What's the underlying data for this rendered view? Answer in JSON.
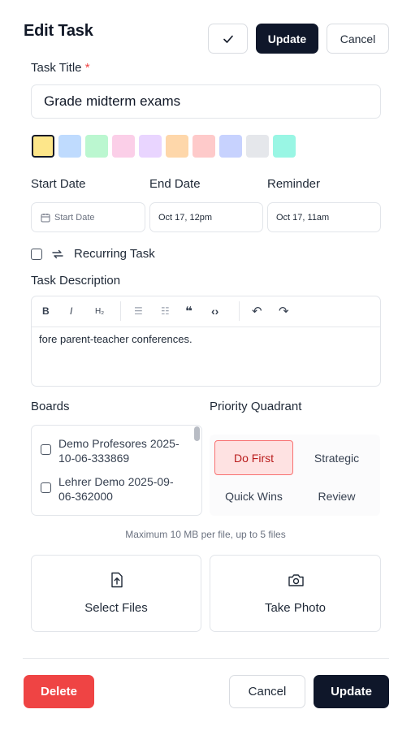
{
  "header": {
    "title": "Edit Task",
    "confirm_icon": "check-icon",
    "update_label": "Update",
    "cancel_label": "Cancel"
  },
  "task_title": {
    "label": "Task Title",
    "required_mark": "*",
    "value": "Grade midterm exams"
  },
  "colors": {
    "swatches": [
      "#fde68a",
      "#bfdbfe",
      "#bbf7d0",
      "#fbcfe8",
      "#e9d5ff",
      "#fed7aa",
      "#fecaca",
      "#c7d2fe",
      "#e5e7eb",
      "#99f6e4"
    ],
    "selected_index": 0
  },
  "dates": {
    "start_label": "Start Date",
    "start_placeholder": "Start Date",
    "end_label": "End Date",
    "end_value": "Oct 17, 12pm",
    "reminder_label": "Reminder",
    "reminder_value": "Oct 17, 11am"
  },
  "recurring": {
    "label": "Recurring Task",
    "checked": false
  },
  "description": {
    "label": "Task Description",
    "toolbar": [
      "B",
      "I",
      "H₂",
      "☰",
      "☷",
      "❝",
      "‹›",
      "↶",
      "↷"
    ],
    "text": "fore parent-teacher conferences."
  },
  "boards": {
    "label": "Boards",
    "items": [
      "Demo Profesores 2025-10-06-333869",
      "Lehrer Demo 2025-09-06-362000"
    ]
  },
  "priority": {
    "label": "Priority Quadrant",
    "quadrants": [
      "Do First",
      "Strategic",
      "Quick Wins",
      "Review"
    ],
    "selected": "Do First"
  },
  "attachments": {
    "hint": "Maximum 10 MB per file, up to 5 files",
    "select_files": "Select Files",
    "take_photo": "Take Photo"
  },
  "footer": {
    "delete_label": "Delete",
    "cancel_label": "Cancel",
    "update_label": "Update"
  }
}
